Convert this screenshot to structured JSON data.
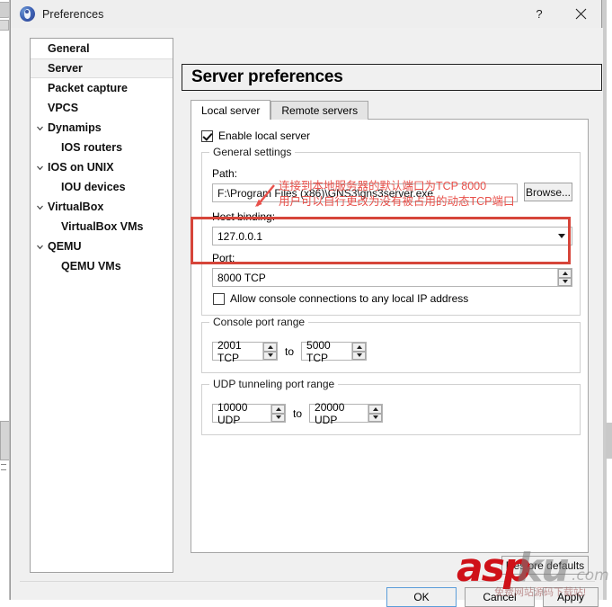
{
  "window": {
    "title": "Preferences",
    "icon": "gns3-app-icon",
    "buttons": [
      {
        "name": "help-button",
        "label": "?"
      },
      {
        "name": "close-button",
        "label": "×"
      }
    ]
  },
  "sidebar": {
    "items": [
      {
        "label": "General",
        "level": 0,
        "expander": "none",
        "selected": false
      },
      {
        "label": "Server",
        "level": 0,
        "expander": "none",
        "selected": true
      },
      {
        "label": "Packet capture",
        "level": 0,
        "expander": "none",
        "selected": false
      },
      {
        "label": "VPCS",
        "level": 0,
        "expander": "none",
        "selected": false
      },
      {
        "label": "Dynamips",
        "level": 0,
        "expander": "expanded",
        "selected": false
      },
      {
        "label": "IOS routers",
        "level": 1,
        "expander": "none",
        "selected": false
      },
      {
        "label": "IOS on UNIX",
        "level": 0,
        "expander": "expanded",
        "selected": false
      },
      {
        "label": "IOU devices",
        "level": 1,
        "expander": "none",
        "selected": false
      },
      {
        "label": "VirtualBox",
        "level": 0,
        "expander": "expanded",
        "selected": false
      },
      {
        "label": "VirtualBox VMs",
        "level": 1,
        "expander": "none",
        "selected": false
      },
      {
        "label": "QEMU",
        "level": 0,
        "expander": "expanded",
        "selected": false
      },
      {
        "label": "QEMU VMs",
        "level": 1,
        "expander": "none",
        "selected": false
      }
    ]
  },
  "panel": {
    "title": "Server preferences",
    "tabs": [
      {
        "label": "Local server",
        "active": true
      },
      {
        "label": "Remote servers",
        "active": false
      }
    ]
  },
  "local_server": {
    "enable_local_server": {
      "label": "Enable local server",
      "checked": true
    },
    "general_settings": {
      "group_title": "General settings",
      "path_label": "Path:",
      "path_value": "F:\\Program Files (x86)\\GNS3\\gns3server.exe",
      "browse_label": "Browse...",
      "host_binding_label": "Host binding:",
      "host_binding_value": "127.0.0.1",
      "port_label": "Port:",
      "port_value": "8000 TCP",
      "allow_console": {
        "label": "Allow console connections to any local IP address",
        "checked": false
      }
    },
    "console_port_range": {
      "group_title": "Console port range",
      "from_value": "2001 TCP",
      "to_label": "to",
      "to_value": "5000 TCP"
    },
    "udp_tunneling_port_range": {
      "group_title": "UDP tunneling port range",
      "from_value": "10000 UDP",
      "to_label": "to",
      "to_value": "20000 UDP"
    }
  },
  "footer": {
    "restore_defaults_label": "Restore defaults",
    "ok_label": "OK",
    "cancel_label": "Cancel",
    "apply_label": "Apply"
  },
  "annotations": {
    "color": "#e8504a",
    "highlight_color": "#d6453a",
    "line1": "连接到本地服务器的默认端口为TCP 8000",
    "line2": "用户可以自行更改为没有被占用的动态TCP端口",
    "arrow": "red-arrow-icon",
    "highlighted_field": "port"
  },
  "watermark": {
    "part_red": "asp",
    "part_gray": "ku",
    "part_domain": ".com",
    "subtitle": "免费网站源码下载站!"
  }
}
